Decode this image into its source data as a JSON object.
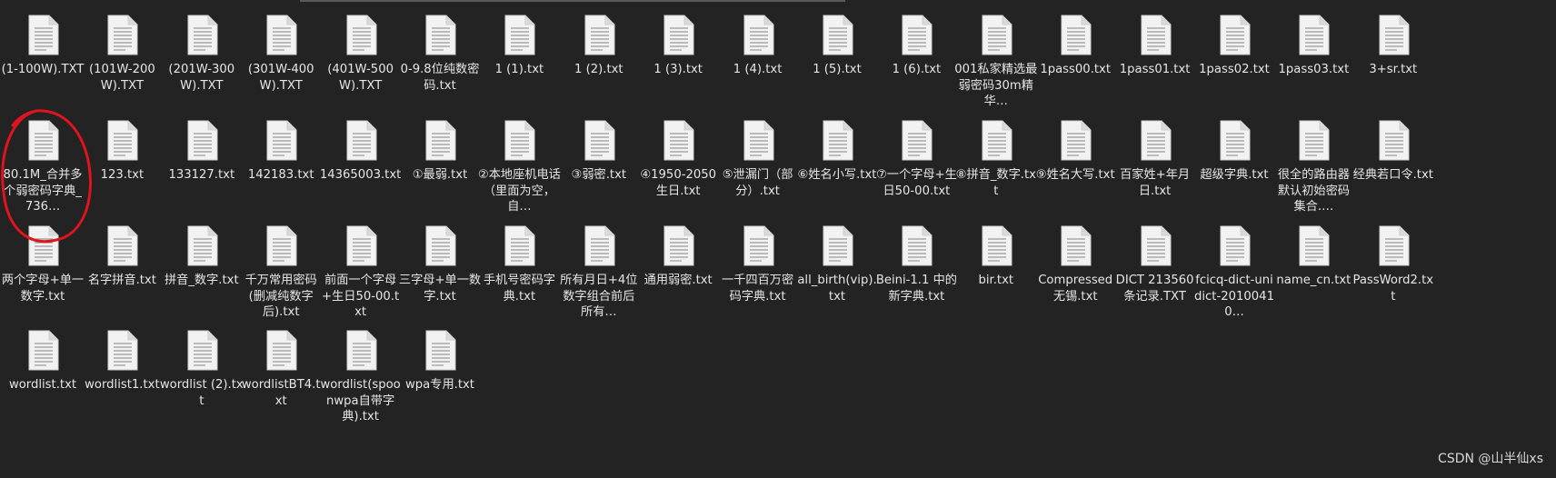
{
  "files": [
    [
      "(1-100W).TXT",
      "(101W-200W).TXT",
      "(201W-300W).TXT",
      "(301W-400W).TXT",
      "(401W-500W).TXT",
      "0-9.8位纯数密码.txt",
      "1 (1).txt",
      "1 (2).txt",
      "1 (3).txt",
      "1 (4).txt",
      "1 (5).txt",
      "1 (6).txt",
      "001私家精选最弱密码30m精华…",
      "1pass00.txt",
      "1pass01.txt",
      "1pass02.txt",
      "1pass03.txt",
      "3+sr.txt"
    ],
    [
      "80.1M_合并多个弱密码字典_736…",
      "123.txt",
      "133127.txt",
      "142183.txt",
      "14365003.txt",
      "①最弱.txt",
      "②本地座机电话（里面为空，自…",
      "③弱密.txt",
      "④1950-2050生日.txt",
      "⑤泄漏门（部分）.txt",
      "⑥姓名小写.txt",
      "⑦一个字母+生日50-00.txt",
      "⑧拼音_数字.txt",
      "⑨姓名大写.txt",
      "百家姓+年月日.txt",
      "超级字典.txt",
      "很全的路由器默认初始密码集合.…",
      "经典若口令.txt"
    ],
    [
      "两个字母+单一数字.txt",
      "名字拼音.txt",
      "拼音_数字.txt",
      "千万常用密码(删减纯数字后).txt",
      "前面一个字母+生日50-00.txt",
      "三字母+单一数字.txt",
      "手机号密码字典.txt",
      "所有月日+4位数字组合前后所有…",
      "通用弱密.txt",
      "一千四百万密码字典.txt",
      "all_birth(vip).txt",
      "Beini-1.1 中的新字典.txt",
      "bir.txt",
      "Compressed无锡.txt",
      "DICT 213560 条记录.TXT",
      "fcicq-dict-unidict-20100410…",
      "name_cn.txt",
      "PassWord2.txt"
    ],
    [
      "wordlist.txt",
      "wordlist1.txt",
      "wordlist (2).txt",
      "wordlistBT4.txt",
      "wordlist(spoonwpa自带字典).txt",
      "wpa专用.txt"
    ]
  ],
  "watermark": "CSDN @山半仙xs",
  "colors": {
    "background": "#232323",
    "text": "#e6e6e6",
    "icon": "#f2f2f2",
    "annotation": "#e0141e"
  }
}
